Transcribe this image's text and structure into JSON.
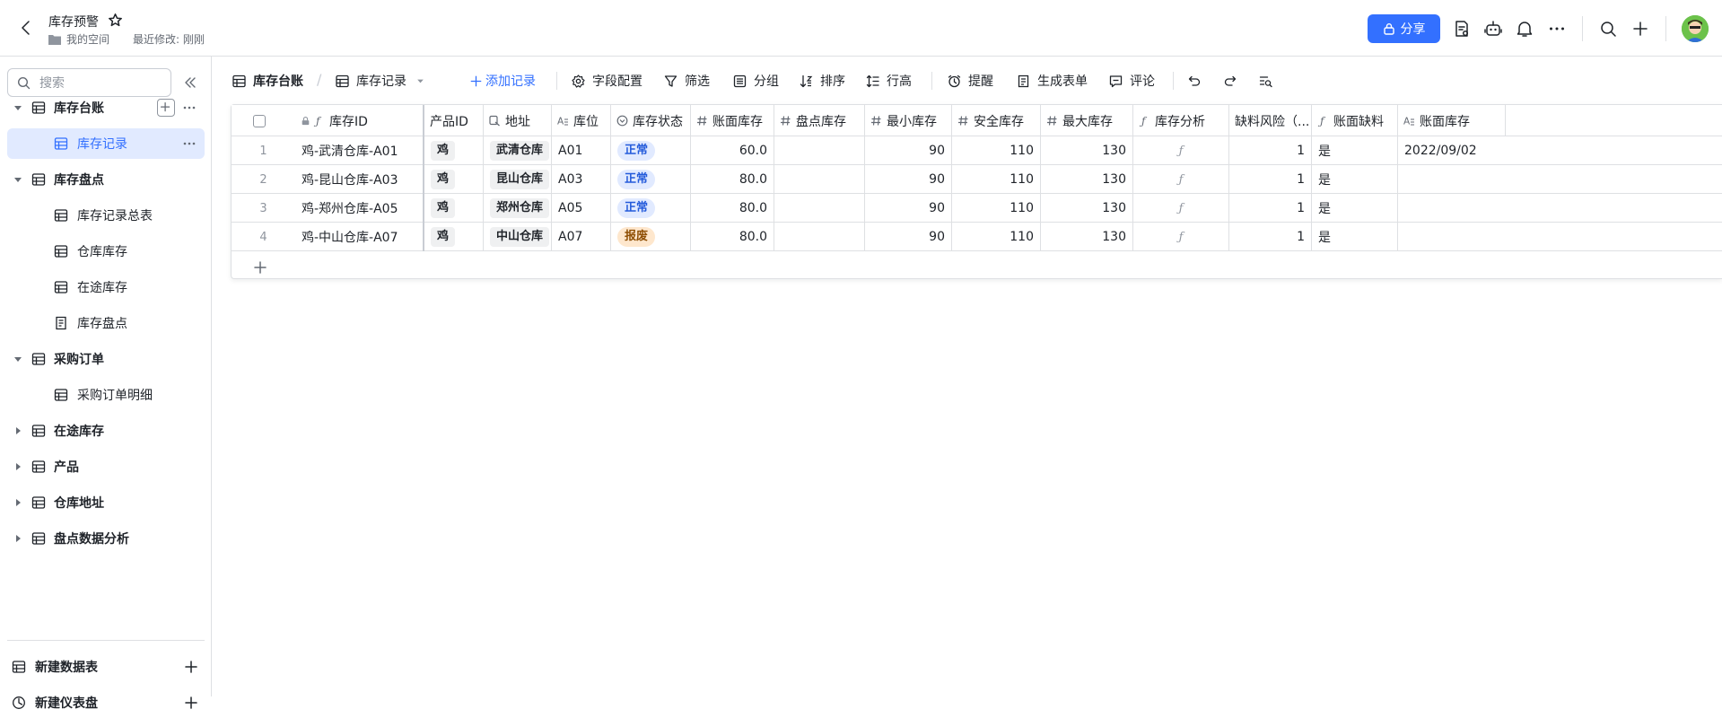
{
  "header": {
    "title": "库存预警",
    "location": "我的空间",
    "last_modified": "最近修改: 刚刚",
    "share_label": "分享"
  },
  "sidebar": {
    "search_placeholder": "搜索",
    "items": [
      {
        "label": "库存台账",
        "level": 0,
        "expanded": true
      },
      {
        "label": "库存记录",
        "level": 1,
        "active": true
      },
      {
        "label": "库存盘点",
        "level": 0,
        "expanded": true
      },
      {
        "label": "库存记录总表",
        "level": 1
      },
      {
        "label": "仓库库存",
        "level": 1
      },
      {
        "label": "在途库存",
        "level": 1
      },
      {
        "label": "库存盘点",
        "level": 1,
        "icon": "form-icon"
      },
      {
        "label": "采购订单",
        "level": 0,
        "expanded": true
      },
      {
        "label": "采购订单明细",
        "level": 1
      },
      {
        "label": "在途库存",
        "level": 0,
        "expanded": false
      },
      {
        "label": "产品",
        "level": 0,
        "expanded": false
      },
      {
        "label": "仓库地址",
        "level": 0,
        "expanded": false
      },
      {
        "label": "盘点数据分析",
        "level": 0,
        "expanded": false
      }
    ],
    "new_table": "新建数据表",
    "new_dashboard": "新建仪表盘"
  },
  "toolbar": {
    "table_name": "库存台账",
    "view_name": "库存记录",
    "add_record": "添加记录",
    "field_config": "字段配置",
    "filter": "筛选",
    "group": "分组",
    "sort": "排序",
    "row_height": "行高",
    "reminder": "提醒",
    "generate_form": "生成表单",
    "comment": "评论"
  },
  "grid": {
    "columns": [
      {
        "label": "库存ID",
        "icon": "formula-icon",
        "locked": true
      },
      {
        "label": "产品ID",
        "icon": ""
      },
      {
        "label": "地址",
        "icon": "link-icon"
      },
      {
        "label": "库位",
        "icon": "text-icon"
      },
      {
        "label": "库存状态",
        "icon": "single-select-icon"
      },
      {
        "label": "账面库存",
        "icon": "number-icon"
      },
      {
        "label": "盘点库存",
        "icon": "number-icon"
      },
      {
        "label": "最小库存",
        "icon": "number-icon"
      },
      {
        "label": "安全库存",
        "icon": "number-icon"
      },
      {
        "label": "最大库存",
        "icon": "number-icon"
      },
      {
        "label": "库存分析",
        "icon": "formula-icon"
      },
      {
        "label": "缺料风险（...",
        "icon": ""
      },
      {
        "label": "账面缺料",
        "icon": "formula-icon"
      },
      {
        "label": "账面库存",
        "icon": "text-icon"
      }
    ],
    "rows": [
      {
        "num": "1",
        "id": "鸡-武清仓库-A01",
        "product": "鸡",
        "address": "武清仓库",
        "bin": "A01",
        "status": "正常",
        "book": "60.0",
        "count": "",
        "min": "90",
        "safe": "110",
        "max": "130",
        "analysis": "ƒ",
        "risk": "1",
        "shortage": "是",
        "date": "2022/09/02"
      },
      {
        "num": "2",
        "id": "鸡-昆山仓库-A03",
        "product": "鸡",
        "address": "昆山仓库",
        "bin": "A03",
        "status": "正常",
        "book": "80.0",
        "count": "",
        "min": "90",
        "safe": "110",
        "max": "130",
        "analysis": "ƒ",
        "risk": "1",
        "shortage": "是",
        "date": ""
      },
      {
        "num": "3",
        "id": "鸡-郑州仓库-A05",
        "product": "鸡",
        "address": "郑州仓库",
        "bin": "A05",
        "status": "正常",
        "book": "80.0",
        "count": "",
        "min": "90",
        "safe": "110",
        "max": "130",
        "analysis": "ƒ",
        "risk": "1",
        "shortage": "是",
        "date": ""
      },
      {
        "num": "4",
        "id": "鸡-中山仓库-A07",
        "product": "鸡",
        "address": "中山仓库",
        "bin": "A07",
        "status": "报废",
        "book": "80.0",
        "count": "",
        "min": "90",
        "safe": "110",
        "max": "130",
        "analysis": "ƒ",
        "risk": "1",
        "shortage": "是",
        "date": ""
      }
    ],
    "status_colors": {
      "正常": {
        "bg": "#e1eaff",
        "fg": "#245bdb"
      },
      "报废": {
        "bg": "#fee7cd",
        "fg": "#8f4f04"
      }
    }
  },
  "colors": {
    "accent": "#3370ff",
    "active_bg": "#e1eaff",
    "border": "#dee0e3"
  }
}
